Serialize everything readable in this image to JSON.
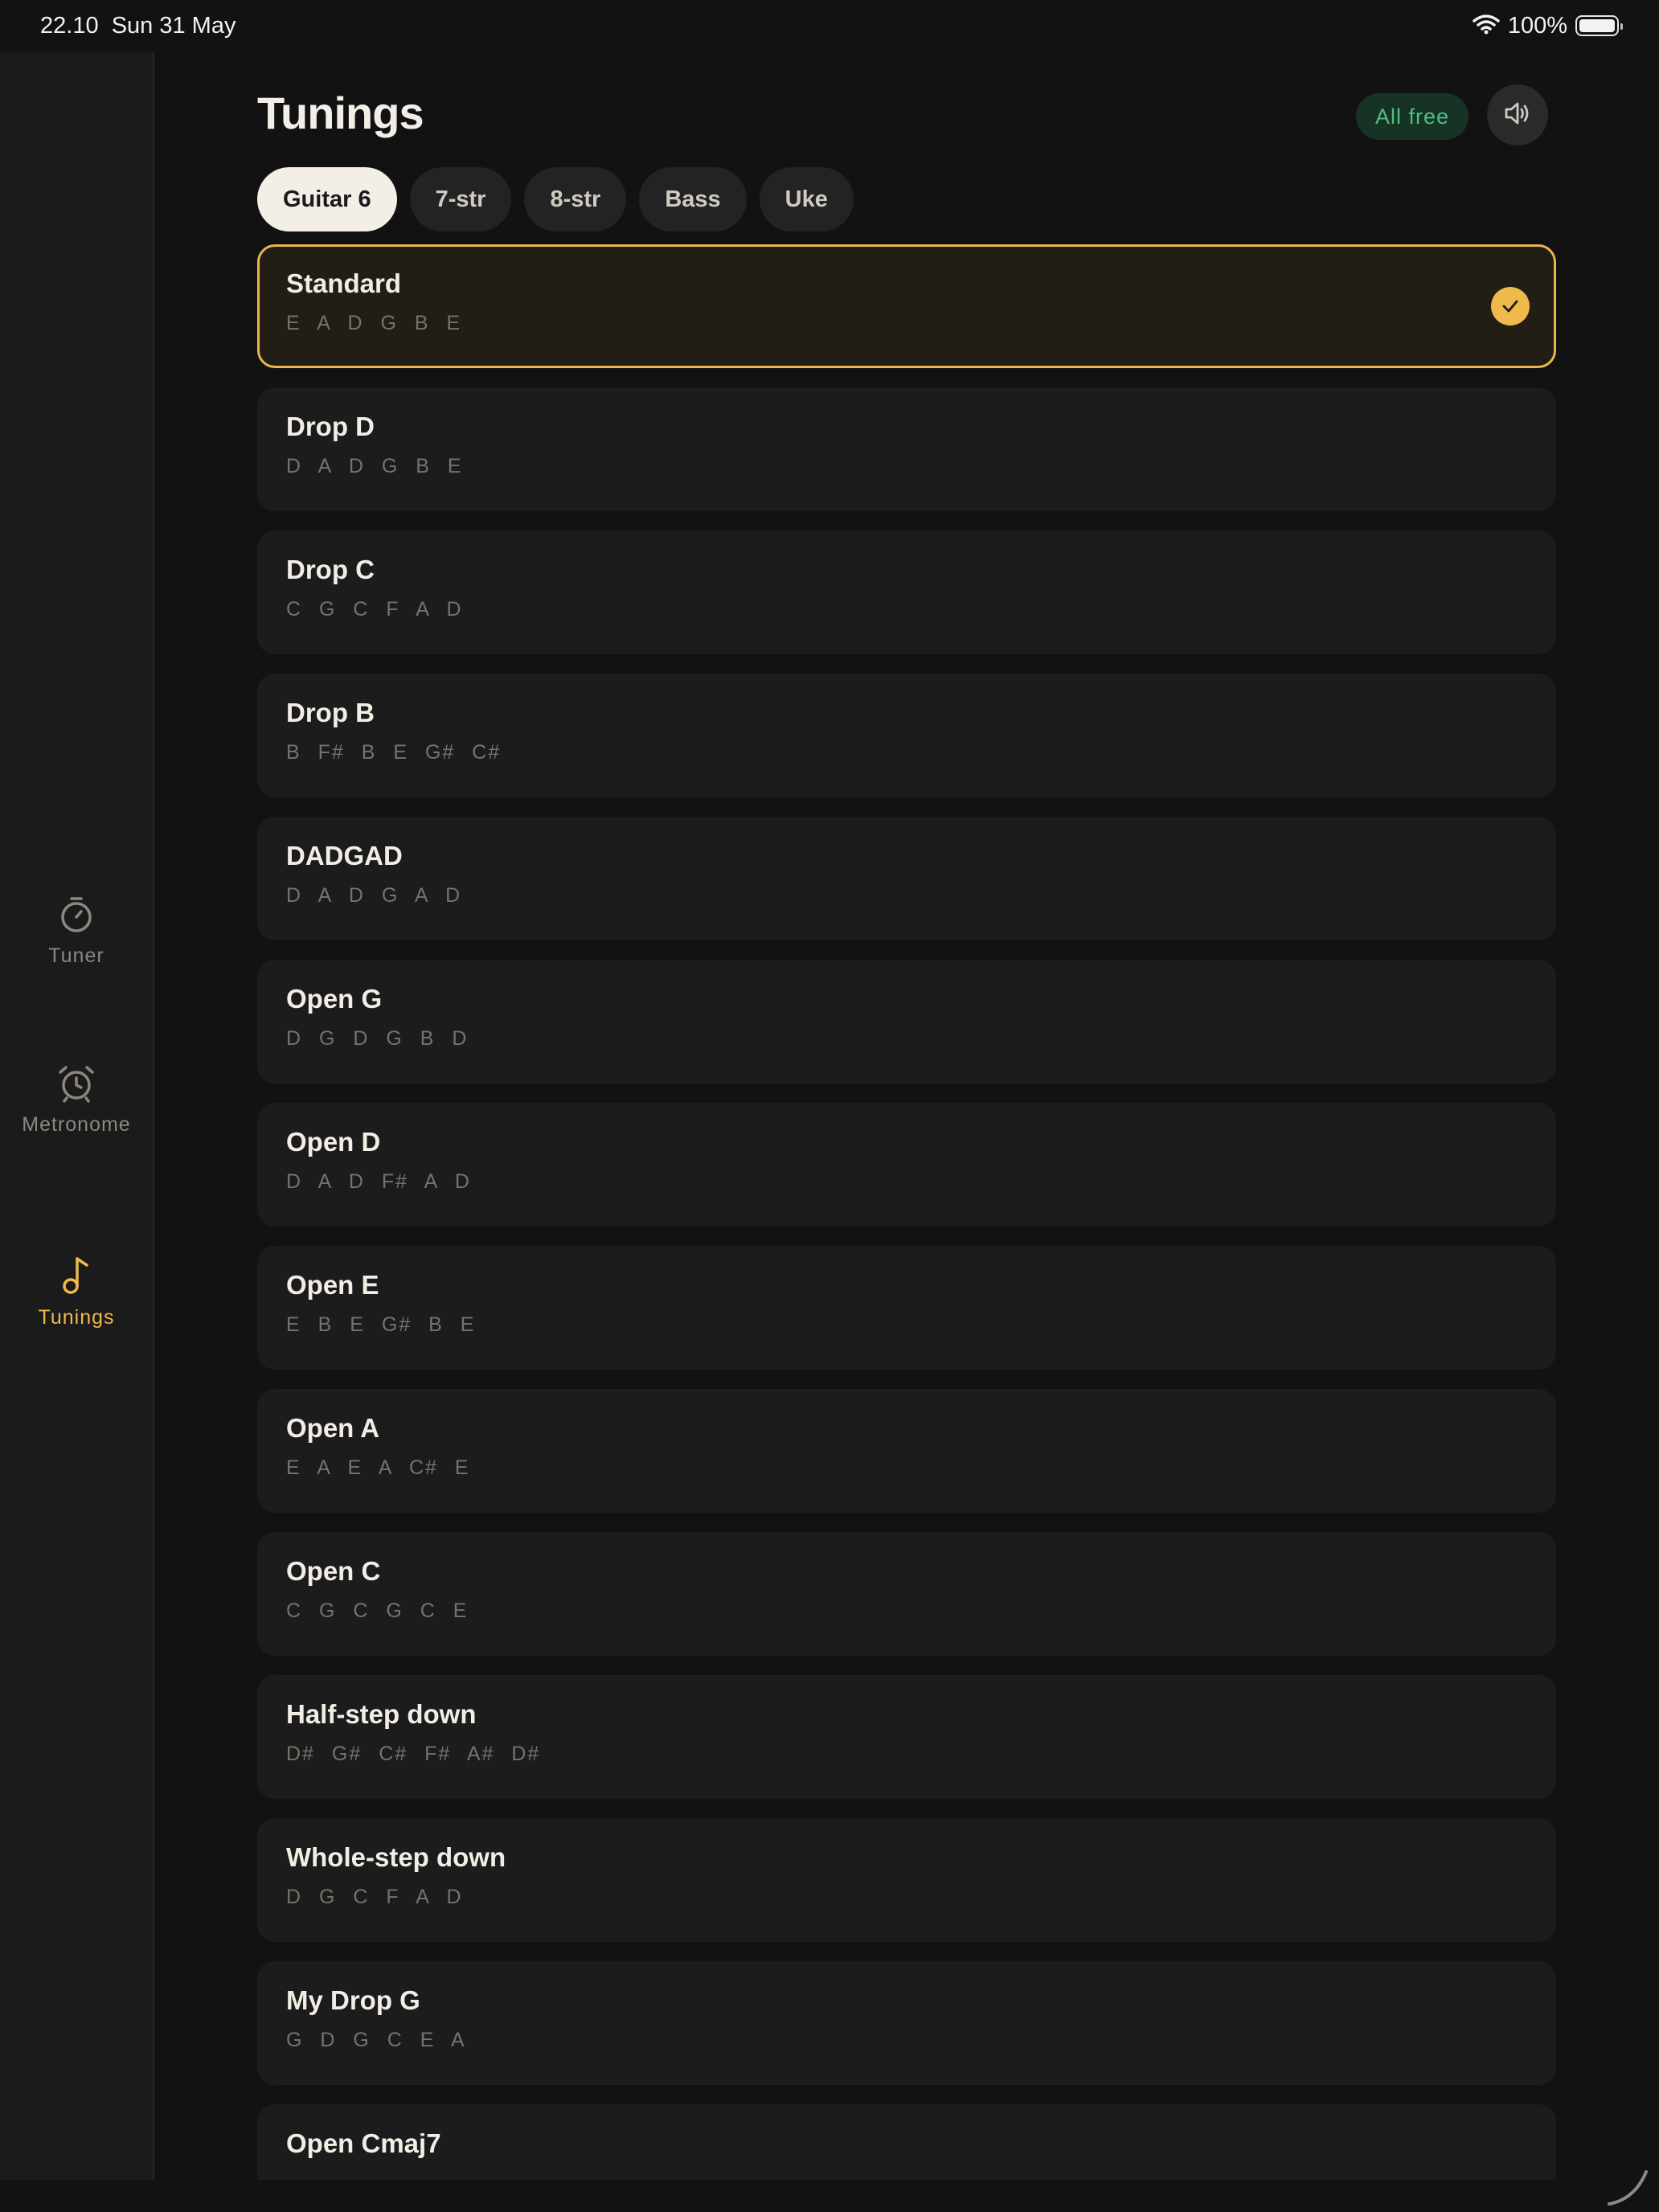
{
  "status": {
    "time": "22.10",
    "date": "Sun 31 May",
    "battery": "100%",
    "battery_level": 1.0
  },
  "sidebar": {
    "items": [
      {
        "label": "Tuner",
        "icon": "stopwatch-icon",
        "active": false
      },
      {
        "label": "Metronome",
        "icon": "alarm-clock-icon",
        "active": false
      },
      {
        "label": "Tunings",
        "icon": "music-note-icon",
        "active": true
      }
    ],
    "accent": "#f0b94c"
  },
  "header": {
    "title": "Tunings",
    "badge": "All free",
    "sound_icon": "speaker-icon"
  },
  "tabs": [
    {
      "label": "Guitar 6",
      "active": true
    },
    {
      "label": "7-str",
      "active": false
    },
    {
      "label": "8-str",
      "active": false
    },
    {
      "label": "Bass",
      "active": false
    },
    {
      "label": "Uke",
      "active": false
    }
  ],
  "tunings": [
    {
      "name": "Standard",
      "notes": "E A D G B E",
      "selected": true
    },
    {
      "name": "Drop D",
      "notes": "D A D G B E",
      "selected": false
    },
    {
      "name": "Drop C",
      "notes": "C G C F A D",
      "selected": false
    },
    {
      "name": "Drop B",
      "notes": "B F# B E G# C#",
      "selected": false
    },
    {
      "name": "DADGAD",
      "notes": "D A D G A D",
      "selected": false
    },
    {
      "name": "Open G",
      "notes": "D G D G B D",
      "selected": false
    },
    {
      "name": "Open D",
      "notes": "D A D F# A D",
      "selected": false
    },
    {
      "name": "Open E",
      "notes": "E B E G# B E",
      "selected": false
    },
    {
      "name": "Open A",
      "notes": "E A E A C# E",
      "selected": false
    },
    {
      "name": "Open C",
      "notes": "C G C G C E",
      "selected": false
    },
    {
      "name": "Half-step down",
      "notes": "D# G# C# F# A# D#",
      "selected": false
    },
    {
      "name": "Whole-step down",
      "notes": "D G C F A D",
      "selected": false
    },
    {
      "name": "My Drop G",
      "notes": "G D G C E A",
      "selected": false
    },
    {
      "name": "Open Cmaj7",
      "notes": "",
      "selected": false
    }
  ]
}
